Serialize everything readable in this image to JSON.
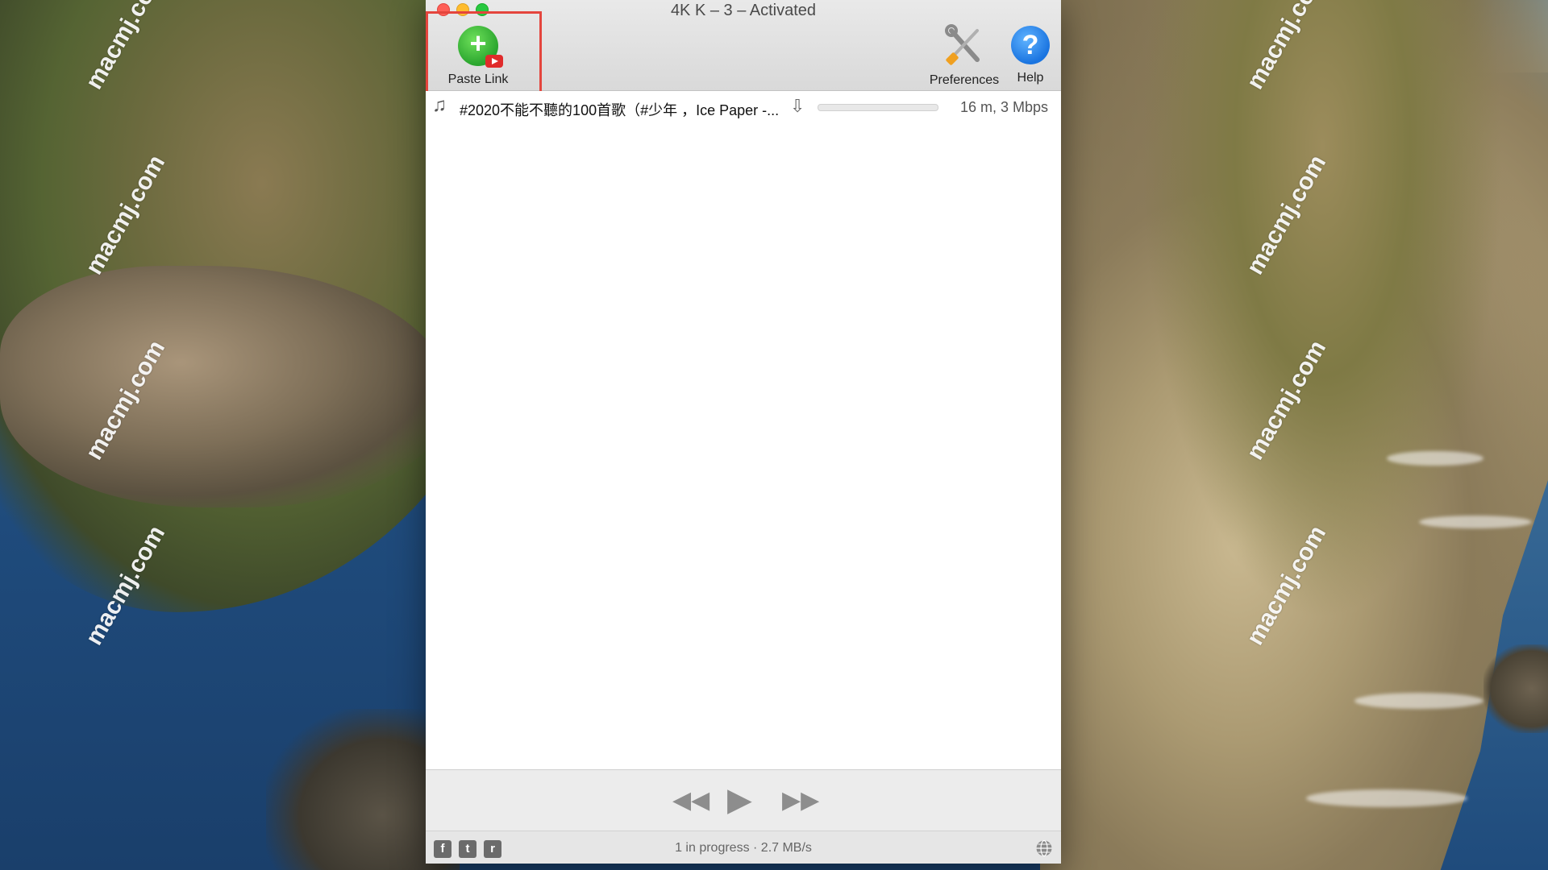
{
  "window": {
    "title": "4K K         – 3 – Activated"
  },
  "toolbar": {
    "paste_label": "Paste Link",
    "paste_icon": "paste-link-icon",
    "preferences_label": "Preferences",
    "preferences_icon": "wrench-screwdriver-icon",
    "help_label": "Help",
    "help_icon": "question-icon",
    "help_glyph": "?"
  },
  "downloads": [
    {
      "icon": "music-note-icon",
      "title": "#2020不能不聽的100首歌（#少年 ，Ice Paper -...",
      "status_icon": "download-arrow-icon",
      "progress": 0,
      "meta": "16 m, 3 Mbps"
    }
  ],
  "player": {
    "rewind_icon": "rewind-icon",
    "play_icon": "play-icon",
    "forward_icon": "fast-forward-icon"
  },
  "statusbar": {
    "facebook": "f",
    "twitter": "t",
    "reddit": "r",
    "status": "1 in progress · 2.7 MB/s",
    "globe_icon": "globe-icon"
  },
  "watermark": "macmj.com",
  "colors": {
    "highlight": "#e4453d",
    "paste_green": "#2aa52e",
    "help_blue": "#1a74e0"
  }
}
